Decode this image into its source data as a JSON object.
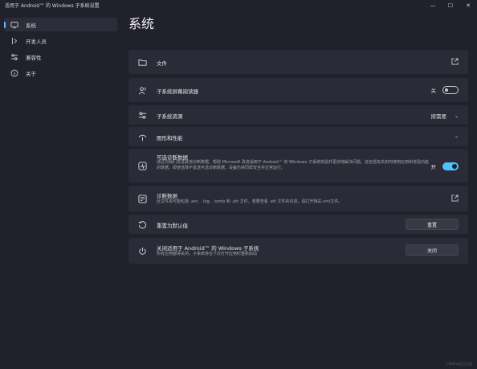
{
  "window": {
    "title": "适用于 Android™ 的 Windows 子系统设置",
    "controls": [
      "—",
      "☐",
      "✕"
    ]
  },
  "sidebar": {
    "items": [
      {
        "label": "系统",
        "icon": "monitor-icon",
        "active": true
      },
      {
        "label": "开发人员",
        "icon": "developer-tools-icon",
        "active": false
      },
      {
        "label": "兼容性",
        "icon": "sliders-icon",
        "active": false
      },
      {
        "label": "关于",
        "icon": "info-icon",
        "active": false
      }
    ]
  },
  "main": {
    "title": "系统",
    "cards": {
      "files": {
        "label": "文件",
        "icon": "folder-icon",
        "action_icon": "open-external-icon"
      },
      "screen_reader": {
        "label": "子系统屏幕阅读器",
        "icon": "screen-reader-icon",
        "toggle_label": "关",
        "toggle_on": false
      },
      "resources": {
        "label": "子系统资源",
        "icon": "sliders-icon",
        "selected_value": "按需要"
      },
      "graphics": {
        "label": "图形和性能",
        "icon": "graphics-icon"
      },
      "optional_diagnostics": {
        "label": "可选诊断数据",
        "icon": "diagnostics-icon",
        "description": "通过向我们发送其他诊断数据，帮助 Microsoft 改进适用于 Android™ 的 Windows 子系统体验并更快地解决问题。这包括有关如何使用应用和增强功能的数据。即使选择不发送可选诊断数据，设备仍将同样安全并正常运行。",
        "toggle_label": "开",
        "toggle_on": true
      },
      "diagnostic_data": {
        "label": "诊断数据",
        "icon": "diagnostic-data-icon",
        "description": "此文件夹可能包括 .anr、.log、.tomb 和 .ett 文件。若要查看 .ett 文件的内容，请打开相关.xml文件。",
        "action_icon": "open-external-icon"
      },
      "reset": {
        "label": "重置为默认值",
        "icon": "reset-icon",
        "button_label": "重置"
      },
      "shutdown": {
        "label": "关闭适用于 Android™ 的 Windows 子系统",
        "icon": "power-icon",
        "description": "所有应用都将关闭，子系统将在下次打开应用时重新启动",
        "button_label": "关闭"
      }
    }
  },
  "colors": {
    "background": "#20212b",
    "card": "#2a2b36",
    "accent": "#4cc2ff"
  },
  "watermark": "CSDN @旧日之痕"
}
